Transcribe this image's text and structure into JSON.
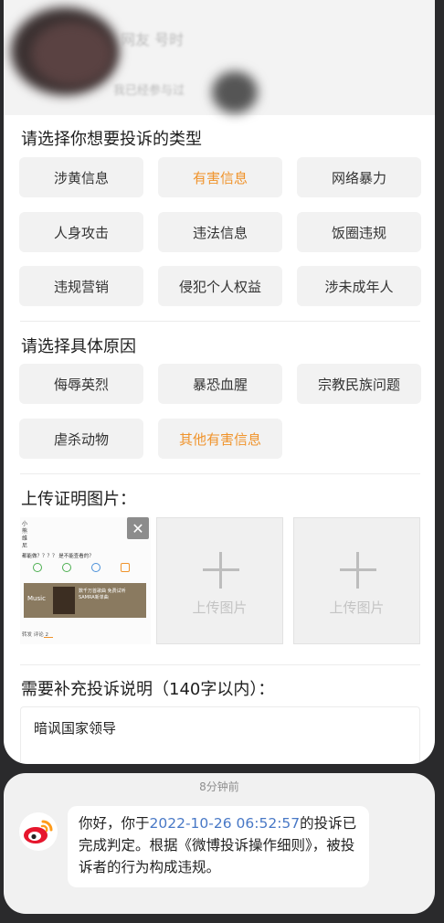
{
  "header": {
    "obscured_name": "网友 号时",
    "obscured_subtitle": "我已经参与过"
  },
  "complaint_type": {
    "title": "请选择你想要投诉的类型",
    "options": [
      "涉黄信息",
      "有害信息",
      "网络暴力",
      "人身攻击",
      "违法信息",
      "饭圈违规",
      "违规营销",
      "侵犯个人权益",
      "涉未成年人"
    ],
    "selected": "有害信息"
  },
  "reason": {
    "title": "请选择具体原因",
    "options": [
      "侮辱英烈",
      "暴恐血腥",
      "宗教民族问题",
      "虐杀动物",
      "其他有害信息"
    ],
    "selected": "其他有害信息"
  },
  "upload": {
    "title": "上传证明图片：",
    "slot_label": "上传图片",
    "thumbnail": {
      "line1": "小",
      "line2": "熊",
      "line3": "维",
      "line4": "尼",
      "question": "都能做？？？？ 是不能查看的？",
      "music_brand": "Music",
      "music_caption": "数千万首歌曲 免费试听 SAMRA新单曲",
      "tabs": "转发  评论 2"
    }
  },
  "explanation": {
    "title": "需要补充投诉说明（140字以内）：",
    "value": "暗讽国家领导"
  },
  "notification": {
    "time": "8分钟前",
    "text_before": "你好，你于",
    "datetime": "2022-10-26 06:52:57",
    "text_after": "的投诉已完成判定。根据《微博投诉操作细则》，被投诉者的行为构成违规。"
  },
  "colors": {
    "selected": "#f0932b",
    "link": "#4878c6",
    "weibo_red": "#e6162d",
    "weibo_orange": "#ff9b1a"
  }
}
